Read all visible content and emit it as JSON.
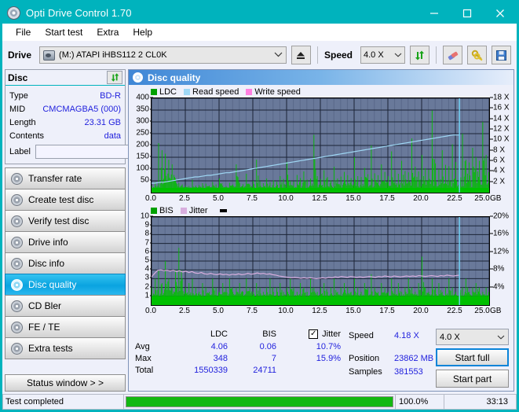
{
  "window": {
    "title": "Opti Drive Control 1.70",
    "app_icon": "disc-icon",
    "minimize": "minimize-icon",
    "maximize": "maximize-icon",
    "close": "close-icon"
  },
  "menu": [
    {
      "label": "File"
    },
    {
      "label": "Start test"
    },
    {
      "label": "Extra"
    },
    {
      "label": "Help"
    }
  ],
  "toolbar": {
    "drive_label": "Drive",
    "drive_value": "(M:)  ATAPI iHBS112  2 CL0K",
    "eject_icon": "eject-icon",
    "speed_label": "Speed",
    "speed_value": "4.0 X",
    "refresh_icon": "refresh-icon",
    "erase_icon": "eraser-icon",
    "keys_icon": "keys-icon",
    "save_icon": "save-icon"
  },
  "disc_panel": {
    "title": "Disc",
    "refresh_icon": "refresh-icon",
    "rows": [
      {
        "key": "Type",
        "value": "BD-R"
      },
      {
        "key": "MID",
        "value": "CMCMAGBA5 (000)"
      },
      {
        "key": "Length",
        "value": "23.31 GB"
      },
      {
        "key": "Contents",
        "value": "data"
      }
    ],
    "label_key": "Label",
    "label_value": "",
    "label_placeholder": "",
    "label_button_icon": "cd-icon"
  },
  "sidebar": {
    "items": [
      {
        "label": "Transfer rate",
        "active": false
      },
      {
        "label": "Create test disc",
        "active": false
      },
      {
        "label": "Verify test disc",
        "active": false
      },
      {
        "label": "Drive info",
        "active": false
      },
      {
        "label": "Disc info",
        "active": false
      },
      {
        "label": "Disc quality",
        "active": true
      },
      {
        "label": "CD Bler",
        "active": false
      },
      {
        "label": "FE / TE",
        "active": false
      },
      {
        "label": "Extra tests",
        "active": false
      }
    ],
    "status_button": "Status window > >"
  },
  "main": {
    "header_title": "Disc quality",
    "header_icon": "disc-quality-icon"
  },
  "results": {
    "columns": [
      "LDC",
      "BIS"
    ],
    "jitter_label": "Jitter",
    "jitter_checked": true,
    "rows": [
      {
        "key": "Avg",
        "ldc": "4.06",
        "bis": "0.06",
        "jitter": "10.7%"
      },
      {
        "key": "Max",
        "ldc": "348",
        "bis": "7",
        "jitter": "15.9%"
      },
      {
        "key": "Total",
        "ldc": "1550339",
        "bis": "24711",
        "jitter": ""
      }
    ],
    "speed_key": "Speed",
    "speed_value": "4.18 X",
    "position_key": "Position",
    "position_value": "23862 MB",
    "samples_key": "Samples",
    "samples_value": "381553",
    "speed_select": "4.0 X",
    "start_full": "Start full",
    "start_part": "Start part"
  },
  "statusbar": {
    "text": "Test completed",
    "percent_label": "100.0%",
    "percent_value": 100,
    "time": "33:13"
  },
  "colors": {
    "accent": "#00b3bd",
    "plot_bg": "#69799a",
    "ldc": "#00c000",
    "bis": "#00c000",
    "read_speed": "#9fd8f5",
    "write_speed": "#ff80e0",
    "jitter": "#d8aede",
    "link": "#2222dd",
    "progress": "#12b812"
  },
  "chart_data": [
    {
      "type": "line",
      "title": "LDC / Read speed",
      "xlabel": "GB",
      "ylabel": "LDC",
      "legend": [
        {
          "name": "LDC",
          "color": "#00a000"
        },
        {
          "name": "Read speed",
          "color": "#9fd8f5"
        },
        {
          "name": "Write speed",
          "color": "#ff80e0"
        }
      ],
      "legend_position": "top-left",
      "grid": true,
      "x": [
        0.0,
        2.5,
        5.0,
        7.5,
        10.0,
        12.5,
        15.0,
        17.5,
        20.0,
        22.5,
        25.0
      ],
      "xlim": [
        0.0,
        25.0
      ],
      "xticks": [
        "0.0",
        "2.5",
        "5.0",
        "7.5",
        "10.0",
        "12.5",
        "15.0",
        "17.5",
        "20.0",
        "22.5",
        "25.0"
      ],
      "xunit": "GB",
      "ylim": [
        0,
        400
      ],
      "yticks": [
        400,
        350,
        300,
        250,
        200,
        150,
        100,
        50
      ],
      "y2lim": [
        0,
        18
      ],
      "y2ticks": [
        "18 X",
        "16 X",
        "14 X",
        "12 X",
        "10 X",
        "8 X",
        "6 X",
        "4 X",
        "2 X"
      ],
      "end_marker_x": 22.8,
      "series": [
        {
          "name": "LDC",
          "color": "#00c000",
          "render": "spikes",
          "baseline": 20,
          "values": [
            30,
            45,
            210,
            180,
            165,
            140,
            120,
            60,
            40,
            35,
            30,
            28,
            55,
            30,
            32,
            40,
            38,
            30,
            45,
            35,
            60,
            30,
            28,
            42,
            35,
            120,
            40,
            36,
            80,
            34,
            50,
            140,
            48,
            40,
            60,
            44,
            52,
            46,
            70,
            58,
            130,
            50,
            48,
            75,
            62,
            90,
            55,
            60,
            245,
            70,
            58,
            95,
            66,
            52,
            110,
            60,
            68,
            88,
            74,
            62,
            150,
            70,
            66,
            105,
            78,
            200,
            82,
            74,
            120,
            88,
            70,
            175,
            96,
            80,
            135,
            92,
            86,
            230,
            110,
            90,
            160,
            104,
            98,
            348,
            124,
            100,
            180,
            118,
            112,
            205,
            130,
            115,
            250,
            140,
            128,
            190,
            150,
            135,
            300,
            160
          ]
        },
        {
          "name": "Read speed",
          "color": "#9fd8f5",
          "render": "line",
          "values": [
            1.8,
            1.8,
            1.9,
            2.0,
            2.0,
            2.1,
            2.2,
            2.3,
            2.4,
            2.5,
            2.6,
            2.7,
            2.8,
            2.9,
            3.0,
            3.0,
            3.1,
            3.2,
            3.3,
            3.3,
            3.4,
            3.5,
            3.6,
            3.7,
            3.8,
            3.8,
            3.9,
            4.0,
            4.1,
            4.2,
            4.3,
            4.4,
            4.5,
            4.6,
            4.7,
            4.8,
            4.9,
            5.0,
            5.1,
            5.2,
            5.3,
            5.4,
            5.5,
            5.6,
            5.7,
            5.8,
            5.9,
            6.0,
            6.1,
            6.2,
            6.3,
            6.4,
            6.5,
            6.6,
            6.7,
            6.8,
            6.9,
            7.0,
            7.1,
            7.2,
            7.3,
            7.4,
            7.5,
            7.6,
            7.7,
            7.8,
            7.9,
            8.0,
            8.1,
            8.2,
            8.3,
            8.4,
            8.5,
            8.6,
            8.7,
            8.8,
            8.9,
            9.0,
            9.1,
            9.2,
            9.3,
            9.4,
            9.5,
            9.6,
            9.7,
            9.8,
            9.9,
            10.0,
            10.1,
            10.2,
            10.3,
            10.4,
            10.5,
            10.6,
            10.7,
            10.8,
            10.9,
            11.0,
            11.0,
            11.0
          ]
        }
      ]
    },
    {
      "type": "line",
      "title": "BIS / Jitter",
      "xlabel": "GB",
      "ylabel": "BIS",
      "legend": [
        {
          "name": "BIS",
          "color": "#00a000"
        },
        {
          "name": "Jitter",
          "color": "#d8aede"
        }
      ],
      "legend_position": "top-left",
      "grid": true,
      "xlim": [
        0.0,
        25.0
      ],
      "xticks": [
        "0.0",
        "2.5",
        "5.0",
        "7.5",
        "10.0",
        "12.5",
        "15.0",
        "17.5",
        "20.0",
        "22.5",
        "25.0"
      ],
      "xunit": "GB",
      "ylim": [
        0,
        10
      ],
      "yticks": [
        10,
        9,
        8,
        7,
        6,
        5,
        4,
        3,
        2,
        1
      ],
      "y2lim": [
        0,
        20
      ],
      "y2ticks": [
        "20%",
        "16%",
        "12%",
        "8%",
        "4%"
      ],
      "end_marker_x": 22.8,
      "series": [
        {
          "name": "BIS",
          "color": "#00c000",
          "render": "spikes",
          "baseline": 1.0,
          "values": [
            2.0,
            3.0,
            4.0,
            2.5,
            5.0,
            3.0,
            2.0,
            4.0,
            6.5,
            3.0,
            2.0,
            2.5,
            3.0,
            2.0,
            1.5,
            2.5,
            2.0,
            1.5,
            3.0,
            2.0,
            1.5,
            2.5,
            2.0,
            3.0,
            1.5,
            2.0,
            2.5,
            1.5,
            3.0,
            2.0,
            1.5,
            2.5,
            2.0,
            1.5,
            2.0,
            3.0,
            1.5,
            2.0,
            2.5,
            1.5,
            2.0,
            3.0,
            2.0,
            1.5,
            2.5,
            2.0,
            1.5,
            3.0,
            2.0,
            1.5,
            2.0,
            2.5,
            1.5,
            2.0,
            3.0,
            1.5,
            2.0,
            2.5,
            2.0,
            1.5,
            3.0,
            2.0,
            1.5,
            2.5,
            2.0,
            3.5,
            2.0,
            1.5,
            2.5,
            2.0,
            1.5,
            3.0,
            2.0,
            2.5,
            1.5,
            2.0,
            3.0,
            2.0,
            1.5,
            2.5,
            5.5,
            2.0,
            1.5,
            3.0,
            2.0,
            2.5,
            1.5,
            2.0,
            3.0,
            2.0,
            1.5,
            2.5,
            2.0,
            3.0,
            1.5,
            2.0,
            2.5,
            2.0,
            1.5,
            2.0
          ]
        },
        {
          "name": "Jitter",
          "color": "#d8aede",
          "render": "line",
          "unit": "%",
          "values": [
            6.4,
            7.2,
            7.9,
            8.0,
            7.8,
            7.9,
            7.7,
            7.9,
            7.6,
            7.8,
            7.5,
            7.7,
            7.4,
            7.6,
            7.3,
            7.2,
            7.4,
            7.1,
            7.0,
            7.2,
            7.0,
            6.9,
            7.1,
            6.9,
            7.0,
            6.8,
            7.0,
            6.9,
            7.1,
            6.9,
            7.0,
            7.2,
            7.0,
            7.1,
            7.3,
            7.1,
            7.2,
            7.0,
            7.1,
            6.9,
            6.8,
            6.6,
            6.5,
            6.4,
            6.3,
            6.2,
            6.3,
            6.2,
            6.1,
            6.2,
            6.1,
            6.2,
            6.1,
            6.0,
            6.1,
            6.2,
            6.1,
            6.3,
            6.2,
            6.4,
            6.3,
            6.5,
            6.4,
            6.3,
            6.5,
            6.4,
            6.3,
            6.4,
            6.3,
            6.4,
            6.5,
            6.4,
            6.3,
            6.5,
            6.4,
            6.6,
            6.5,
            6.4,
            6.6,
            6.5,
            6.4,
            6.5,
            6.6,
            6.5,
            6.6,
            6.5,
            6.7,
            6.6,
            6.5,
            6.6,
            6.7,
            6.6,
            6.5,
            6.7,
            6.6,
            6.8,
            6.7,
            6.6,
            6.7,
            6.8
          ]
        }
      ]
    }
  ]
}
